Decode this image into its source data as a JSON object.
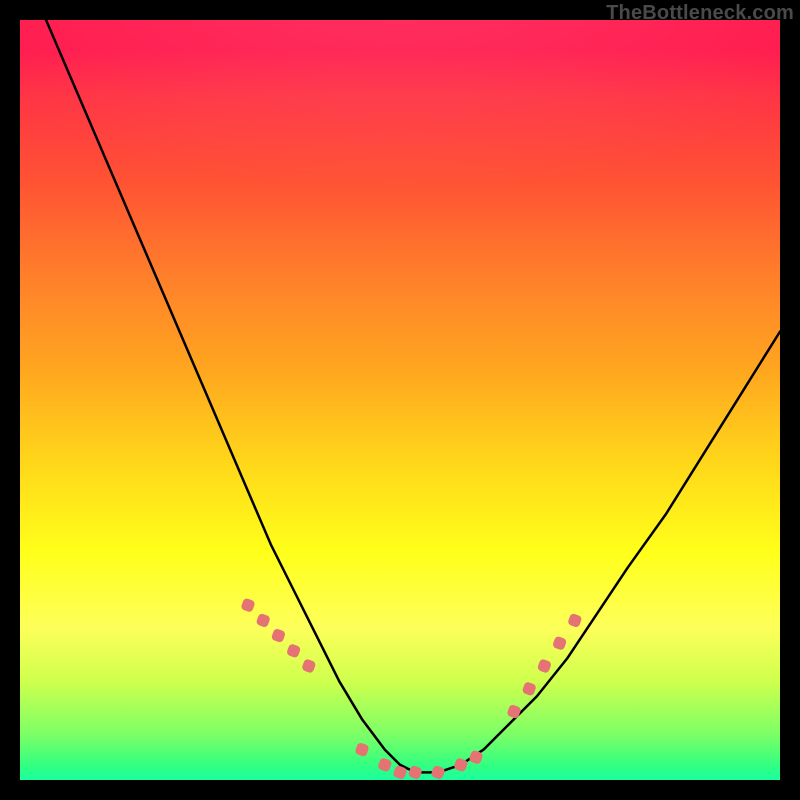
{
  "watermark": "TheBottleneck.com",
  "colors": {
    "background": "#000000",
    "curve": "#000000",
    "marker": "#e57373",
    "gradient_top": "#ff1a4d",
    "gradient_bottom": "#1aff9e"
  },
  "chart_data": {
    "type": "line",
    "title": "",
    "xlabel": "",
    "ylabel": "",
    "xlim": [
      0,
      100
    ],
    "ylim": [
      0,
      100
    ],
    "series": [
      {
        "name": "bottleneck-curve",
        "x": [
          0,
          3,
          6,
          9,
          12,
          15,
          18,
          21,
          24,
          27,
          30,
          33,
          36,
          39,
          42,
          45,
          48,
          50,
          52,
          55,
          58,
          61,
          64,
          68,
          72,
          76,
          80,
          85,
          90,
          95,
          100
        ],
        "y": [
          108,
          101,
          94,
          87,
          80,
          73,
          66,
          59,
          52,
          45,
          38,
          31,
          25,
          19,
          13,
          8,
          4,
          2,
          1,
          1,
          2,
          4,
          7,
          11,
          16,
          22,
          28,
          35,
          43,
          51,
          59
        ]
      }
    ],
    "markers": {
      "name": "highlight-points",
      "x": [
        30,
        32,
        34,
        36,
        38,
        45,
        48,
        50,
        52,
        55,
        58,
        60,
        65,
        67,
        69,
        71,
        73
      ],
      "y": [
        23,
        21,
        19,
        17,
        15,
        4,
        2,
        1,
        1,
        1,
        2,
        3,
        9,
        12,
        15,
        18,
        21
      ]
    }
  }
}
